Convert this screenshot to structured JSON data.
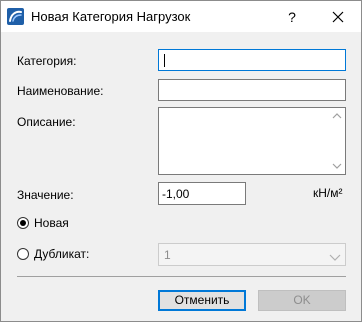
{
  "window": {
    "title": "Новая Категория Нагрузок",
    "help_label": "?"
  },
  "form": {
    "category_label": "Категория:",
    "category_value": "",
    "name_label": "Наименование:",
    "name_value": "",
    "description_label": "Описание:",
    "description_value": "",
    "value_label": "Значение:",
    "value_value": "-1,00",
    "value_unit": "кН/м²"
  },
  "mode": {
    "new_label": "Новая",
    "new_checked": true,
    "duplicate_label": "Дубликат:",
    "duplicate_checked": false,
    "duplicate_select_value": "1"
  },
  "buttons": {
    "cancel_label": "Отменить",
    "ok_label": "OK"
  },
  "colors": {
    "focus_accent": "#0078d7",
    "app_icon": "#1f5fa8",
    "disabled_text": "#8e8e8e"
  },
  "icons": {
    "app": "archicad-app-icon",
    "close": "close-icon",
    "scroll_up": "chevron-up-icon",
    "scroll_down": "chevron-down-icon",
    "dropdown": "chevron-down-icon"
  }
}
